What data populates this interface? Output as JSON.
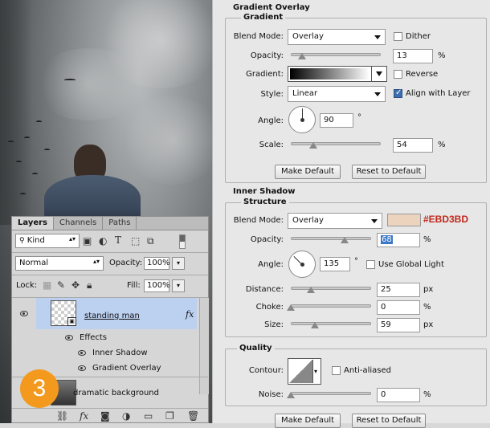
{
  "layers_panel": {
    "tabs": [
      "Layers",
      "Channels",
      "Paths"
    ],
    "filter_kind": "Kind",
    "blend_mode": "Normal",
    "opacity_label": "Opacity:",
    "opacity_value": "100%",
    "lock_label": "Lock:",
    "fill_label": "Fill:",
    "fill_value": "100%",
    "layers": {
      "standing_man": "standing man",
      "fx_label": "fx",
      "effects_label": "Effects",
      "inner_shadow": "Inner Shadow",
      "gradient_overlay": "Gradient Overlay",
      "dramatic_background": "dramatic background"
    },
    "bottom_fx": "fx"
  },
  "step_badge": "3",
  "gradient_overlay": {
    "section_title": "Gradient Overlay",
    "group_title": "Gradient",
    "blend_mode_label": "Blend Mode:",
    "blend_mode": "Overlay",
    "dither_label": "Dither",
    "opacity_label": "Opacity:",
    "opacity": "13",
    "opacity_percent": 13,
    "gradient_label": "Gradient:",
    "reverse_label": "Reverse",
    "style_label": "Style:",
    "style": "Linear",
    "align_label": "Align with Layer",
    "angle_label": "Angle:",
    "angle": "90",
    "scale_label": "Scale:",
    "scale": "54",
    "scale_percent": 54,
    "percent": "%",
    "degree": "°",
    "make_default": "Make Default",
    "reset_default": "Reset to Default"
  },
  "inner_shadow": {
    "section_title": "Inner Shadow",
    "group_title": "Structure",
    "blend_mode_label": "Blend Mode:",
    "blend_mode": "Overlay",
    "color_hex": "#EBD3BD",
    "color_label": "#EBD3BD",
    "opacity_label": "Opacity:",
    "opacity": "68",
    "opacity_percent": 68,
    "angle_label": "Angle:",
    "angle": "135",
    "global_light_label": "Use Global Light",
    "distance_label": "Distance:",
    "distance": "25",
    "choke_label": "Choke:",
    "choke": "0",
    "size_label": "Size:",
    "size": "59",
    "px": "px",
    "percent": "%",
    "degree": "°"
  },
  "quality": {
    "group_title": "Quality",
    "contour_label": "Contour:",
    "anti_aliased_label": "Anti-aliased",
    "noise_label": "Noise:",
    "noise": "0",
    "percent": "%",
    "make_default": "Make Default",
    "reset_default": "Reset to Default"
  },
  "colors": {
    "badge": "#F39A1E",
    "selected_layer": "#bcd0f0",
    "accent_red": "#c0281c"
  }
}
